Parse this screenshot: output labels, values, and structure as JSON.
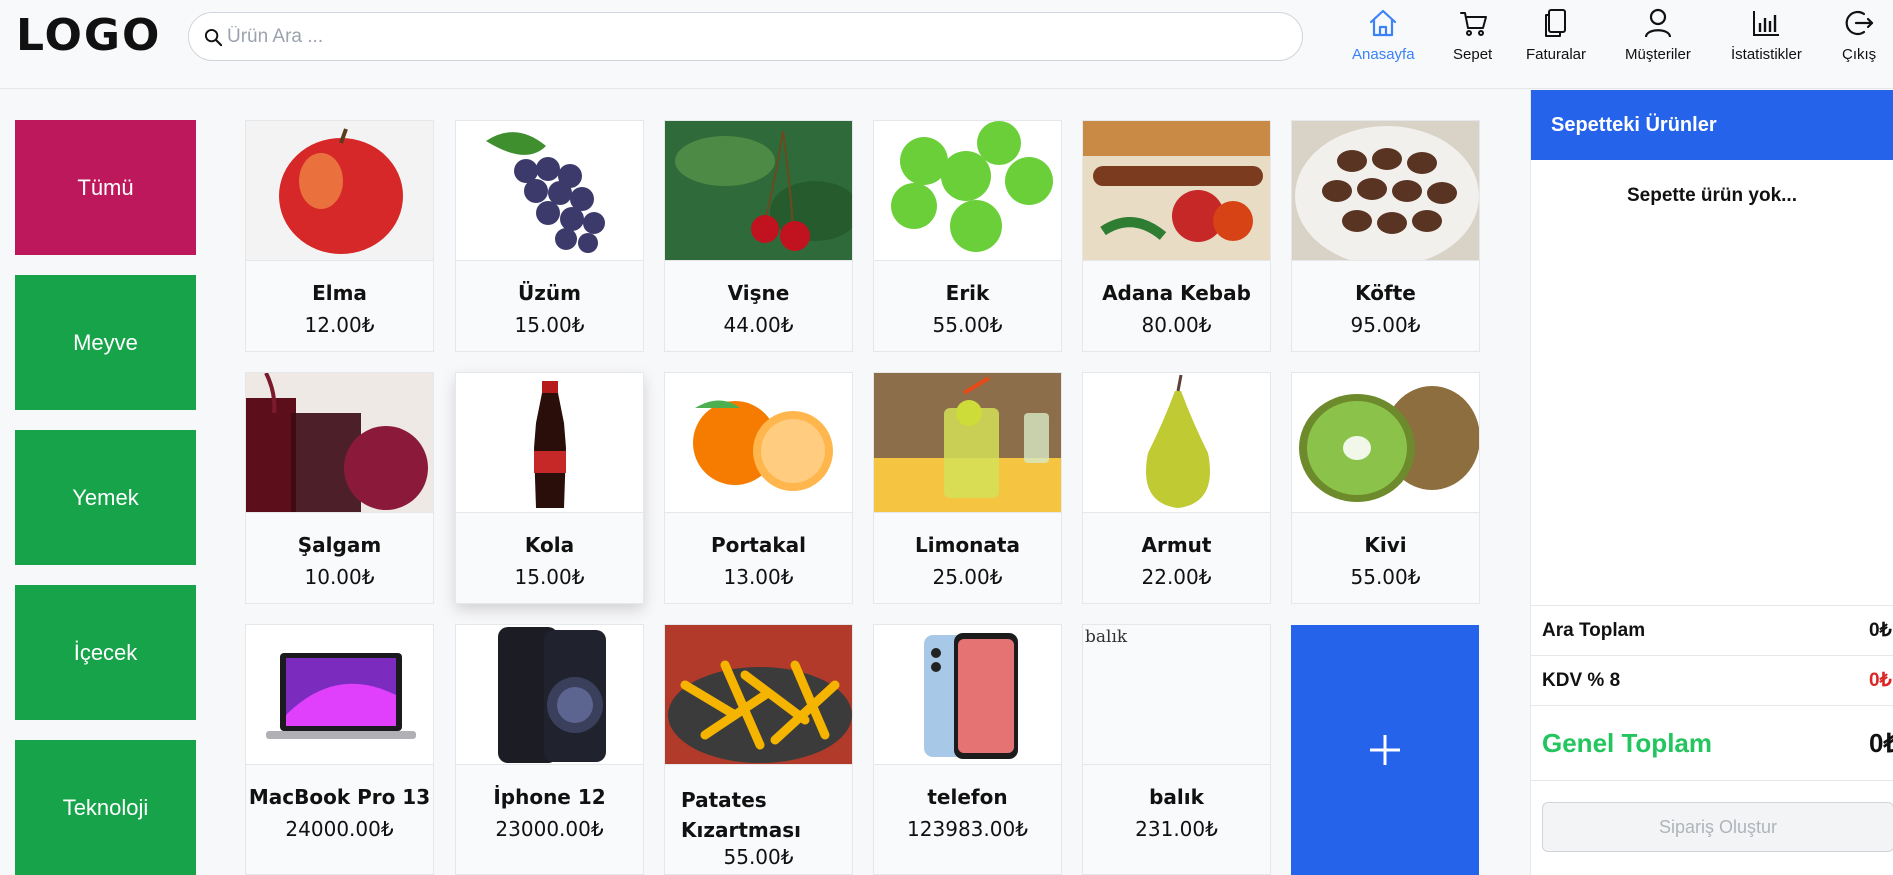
{
  "header": {
    "logo": "LOGO",
    "search_placeholder": "Ürün Ara ...",
    "nav": [
      {
        "label": "Anasayfa",
        "icon": "home-icon"
      },
      {
        "label": "Sepet",
        "icon": "cart-icon"
      },
      {
        "label": "Faturalar",
        "icon": "copy-icon"
      },
      {
        "label": "Müşteriler",
        "icon": "user-icon"
      },
      {
        "label": "İstatistikler",
        "icon": "bar-chart-icon"
      },
      {
        "label": "Çıkış",
        "icon": "logout-icon"
      }
    ]
  },
  "categories": [
    "Tümü",
    "Meyve",
    "Yemek",
    "İçecek",
    "Teknoloji"
  ],
  "products": [
    {
      "name": "Elma",
      "price": "12.00₺"
    },
    {
      "name": "Üzüm",
      "price": "15.00₺"
    },
    {
      "name": "Vişne",
      "price": "44.00₺"
    },
    {
      "name": "Erik",
      "price": "55.00₺"
    },
    {
      "name": "Adana Kebab",
      "price": "80.00₺"
    },
    {
      "name": "Köfte",
      "price": "95.00₺"
    },
    {
      "name": "Şalgam",
      "price": "10.00₺"
    },
    {
      "name": "Kola",
      "price": "15.00₺"
    },
    {
      "name": "Portakal",
      "price": "13.00₺"
    },
    {
      "name": "Limonata",
      "price": "25.00₺"
    },
    {
      "name": "Armut",
      "price": "22.00₺"
    },
    {
      "name": "Kivi",
      "price": "55.00₺"
    },
    {
      "name": "MacBook Pro 13",
      "price": "24000.00₺"
    },
    {
      "name": "İphone 12",
      "price": "23000.00₺"
    },
    {
      "name": "Patates Kızartması",
      "price": "55.00₺"
    },
    {
      "name": "telefon",
      "price": "123983.00₺"
    },
    {
      "name": "balık",
      "price": "231.00₺",
      "broken_alt": "balık"
    }
  ],
  "add_button": "+",
  "cart": {
    "title": "Sepetteki Ürünler",
    "empty": "Sepette ürün yok...",
    "subtotal_label": "Ara Toplam",
    "subtotal_value": "0₺",
    "vat_label": "KDV % 8",
    "vat_value": "0₺",
    "total_label": "Genel Toplam",
    "total_value": "0₺",
    "order_button": "Sipariş Oluştur"
  },
  "colors": {
    "primary": "#2563eb",
    "category_active": "#be185d",
    "category": "#16a34a",
    "nav_active": "#3b82f6",
    "total_label": "#22c55e",
    "vat_value": "#dc2626"
  }
}
